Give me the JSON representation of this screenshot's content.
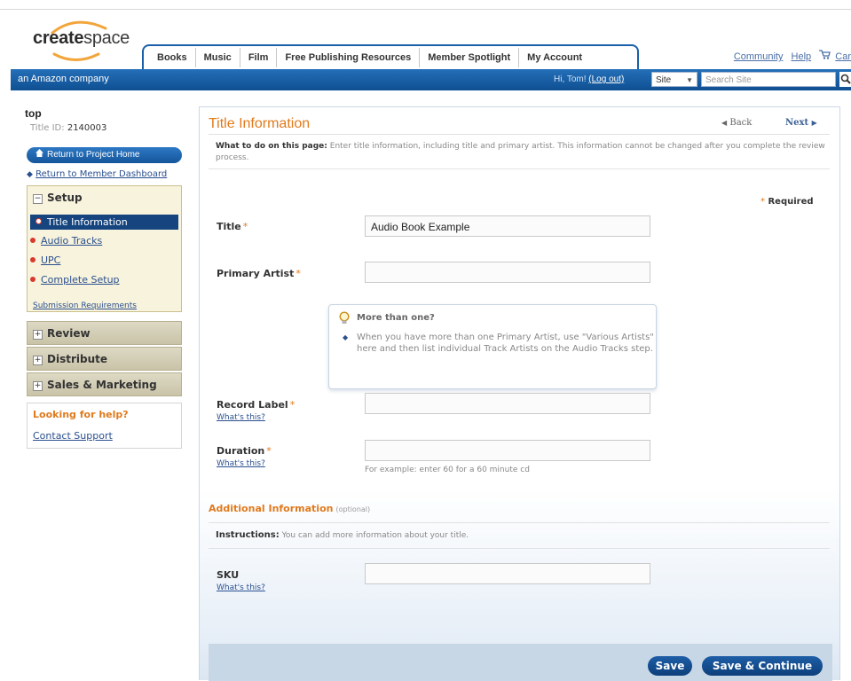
{
  "header": {
    "logo": {
      "prefix": "create",
      "suffix": "space"
    },
    "tabs": [
      "Books",
      "Music",
      "Film",
      "Free Publishing Resources",
      "Member Spotlight",
      "My Account"
    ],
    "utility": {
      "community": "Community",
      "help": "Help",
      "cart": "Car"
    },
    "bar": {
      "company": "an Amazon company",
      "greeting": "Hi, Tom!",
      "logout": "(Log out)",
      "scope_select": "Site",
      "search_placeholder": "Search Site"
    }
  },
  "sidebar": {
    "title": "top",
    "title_id_label": "Title ID:",
    "title_id": "2140003",
    "return_project": "Return to Project Home",
    "return_dashboard": "Return to Member Dashboard",
    "setup_label": "Setup",
    "setup_items": [
      "Title Information",
      "Audio Tracks",
      "UPC",
      "Complete Setup"
    ],
    "submission_req": "Submission Requirements",
    "review_label": "Review",
    "distribute_label": "Distribute",
    "sales_label": "Sales & Marketing",
    "help_title": "Looking for help?",
    "contact": "Contact Support"
  },
  "main": {
    "title": "Title Information",
    "back": "Back",
    "next": "Next",
    "intro_bold": "What to do on this page:",
    "intro_text": "Enter title information, including title and primary artist. This information cannot be changed after you complete the review process.",
    "required_note": "Required",
    "fields": {
      "title_label": "Title",
      "title_value": "Audio Book Example",
      "primary_artist_label": "Primary Artist",
      "primary_artist_value": "",
      "record_label_label": "Record Label",
      "record_label_value": "",
      "duration_label": "Duration",
      "duration_value": "",
      "duration_hint": "For example: enter 60 for a 60 minute cd",
      "sku_label": "SKU",
      "sku_value": "",
      "whats_this": "What's this?"
    },
    "tip": {
      "title": "More than one?",
      "body": "When you have more than one Primary Artist, use \"Various Artists\" here and then list individual Track Artists on the Audio Tracks step."
    },
    "additional_title": "Additional Information",
    "optional": "(optional)",
    "instructions_bold": "Instructions:",
    "instructions_text": "You can add more information about your title.",
    "save": "Save",
    "save_continue": "Save & Continue"
  }
}
